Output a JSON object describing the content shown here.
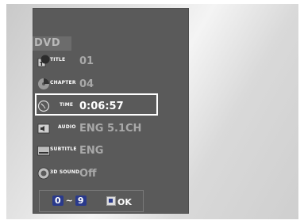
{
  "menu": {
    "header": "DVD",
    "rows": [
      {
        "icon": "title-icon",
        "label": "TITLE",
        "value": "01"
      },
      {
        "icon": "chapter-icon",
        "label": "CHAPTER",
        "value": "04"
      },
      {
        "icon": "time-icon",
        "label": "TIME",
        "value": "0:06:57"
      },
      {
        "icon": "audio-icon",
        "label": "AUDIO",
        "value": "ENG 5.1CH"
      },
      {
        "icon": "subtitle-icon",
        "label": "SUBTITLE",
        "value": "ENG"
      },
      {
        "icon": "3d-sound-icon",
        "label": "3D SOUND",
        "value": "Off"
      }
    ],
    "selected_index": 2
  },
  "footer": {
    "key_start": "0",
    "key_separator": "~",
    "key_end": "9",
    "ok_label": "OK"
  }
}
